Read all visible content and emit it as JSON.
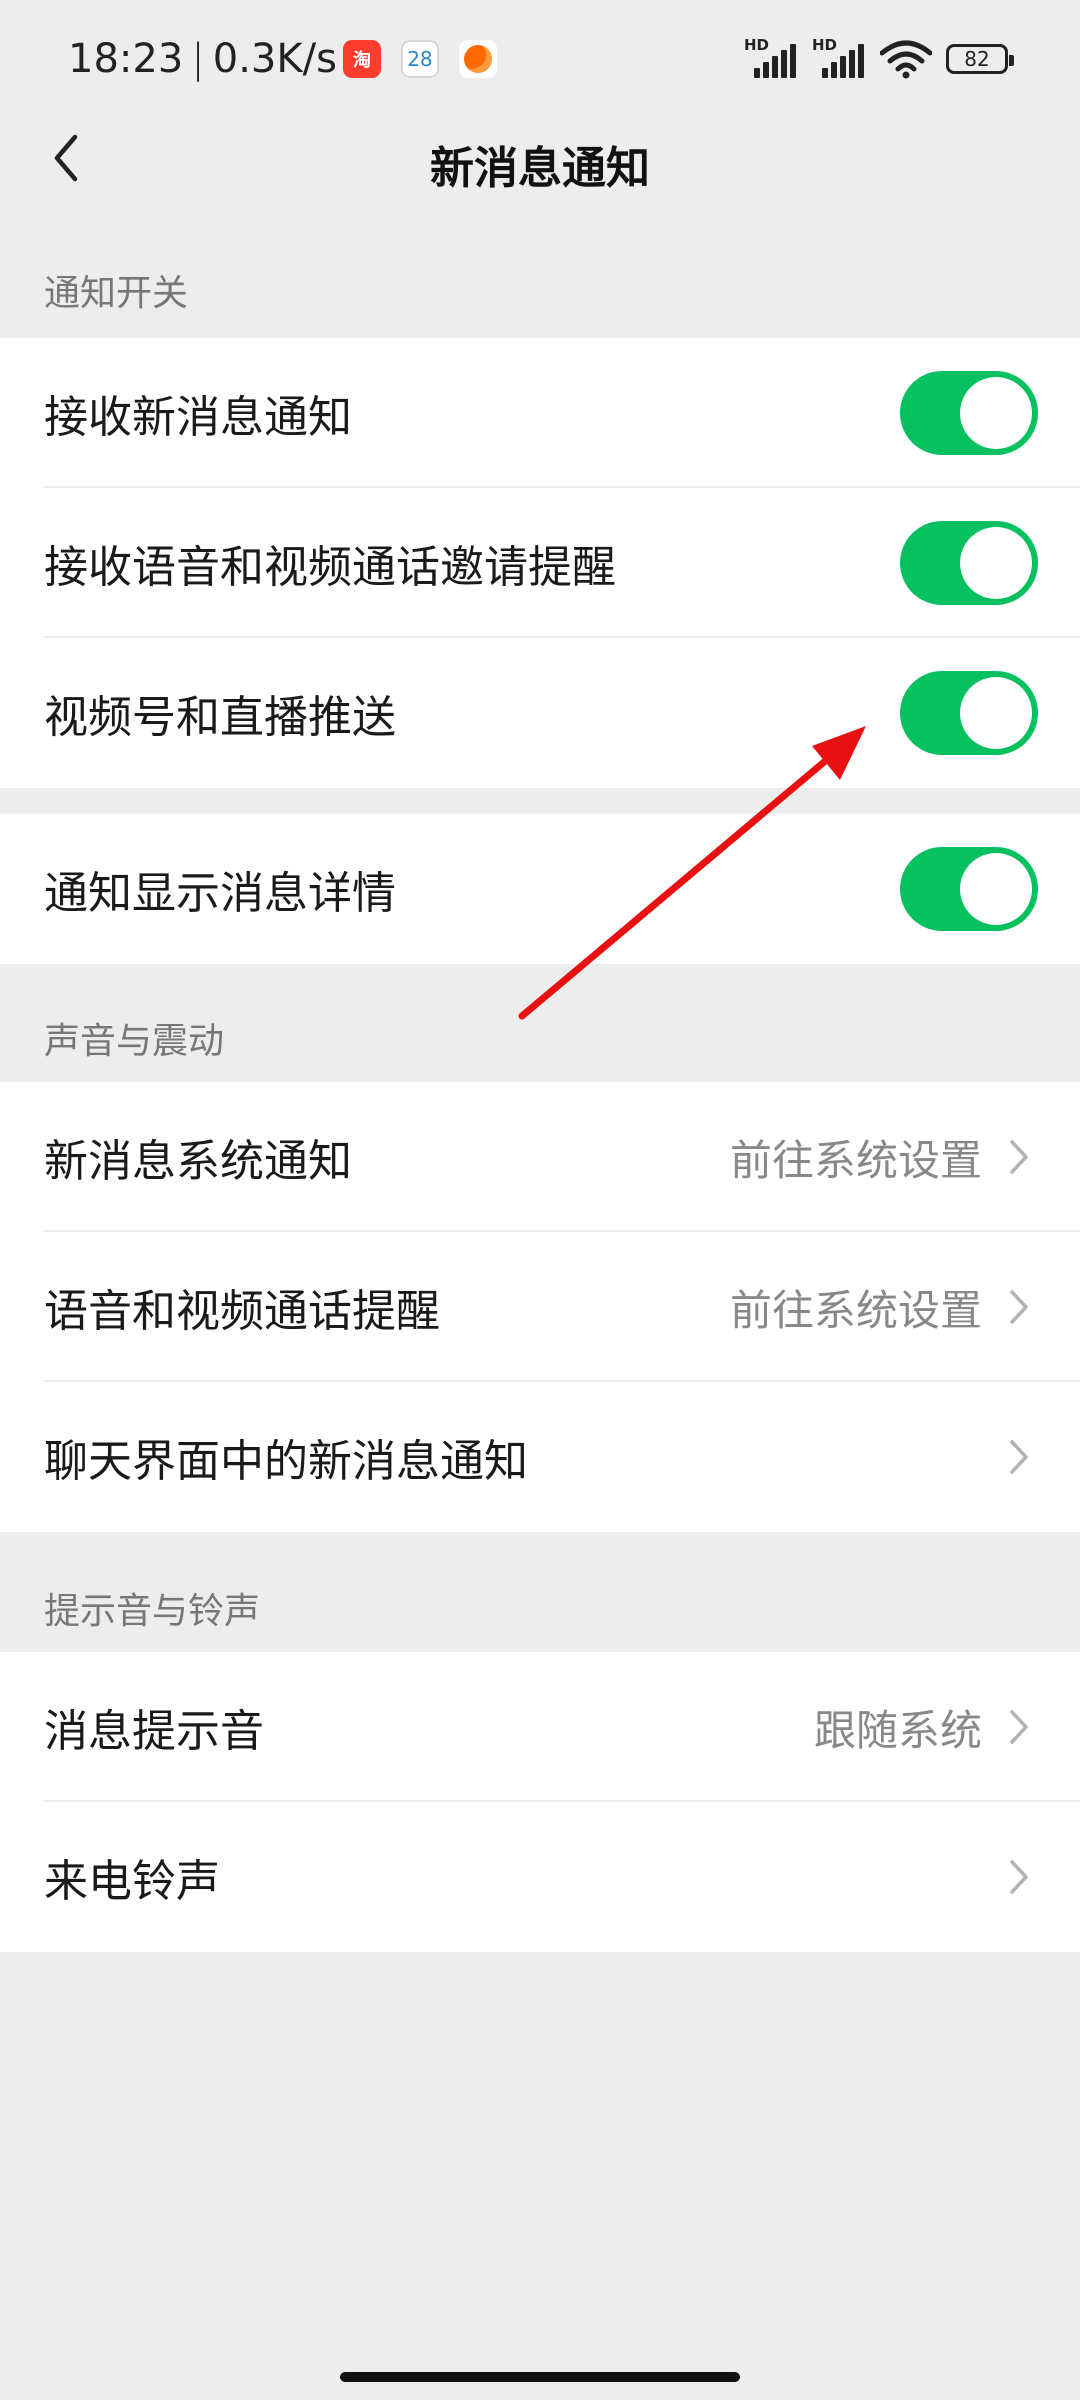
{
  "status_bar": {
    "time": "18:23",
    "separator": "|",
    "net_speed": "0.3K/s",
    "taobao_icon_text": "淘",
    "calendar_icon_text": "28",
    "signal_1_label": "HD",
    "signal_2_label": "HD",
    "battery_level": "82"
  },
  "header": {
    "title": "新消息通知"
  },
  "sections": {
    "notify_switch": {
      "title": "通知开关",
      "items": [
        {
          "label": "接收新消息通知",
          "on": true
        },
        {
          "label": "接收语音和视频通话邀请提醒",
          "on": true
        },
        {
          "label": "视频号和直播推送",
          "on": true
        }
      ],
      "detail_item": {
        "label": "通知显示消息详情",
        "on": true
      }
    },
    "sound_vibration": {
      "title": "声音与震动",
      "items": [
        {
          "label": "新消息系统通知",
          "value": "前往系统设置"
        },
        {
          "label": "语音和视频通话提醒",
          "value": "前往系统设置"
        },
        {
          "label": "聊天界面中的新消息通知",
          "value": ""
        }
      ]
    },
    "ringtone": {
      "title": "提示音与铃声",
      "items": [
        {
          "label": "消息提示音",
          "value": "跟随系统"
        },
        {
          "label": "来电铃声",
          "value": ""
        }
      ]
    }
  },
  "colors": {
    "toggle_on": "#07C160",
    "background": "#EDEDED",
    "annotation_arrow": "#E81010"
  }
}
